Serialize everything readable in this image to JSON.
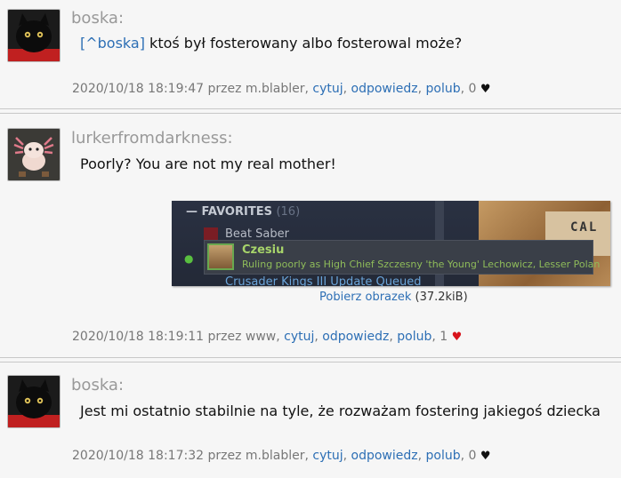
{
  "posts": [
    {
      "author": "boska:",
      "reply_link": "[^boska]",
      "text": " ktoś był fosterowany albo fosterowal może?",
      "meta": {
        "prefix": "2020/10/18 18:19:47 przez m.blabler, ",
        "cytuj": "cytuj",
        "odpowiedz": "odpowiedz",
        "polub": "polub",
        "likes": "0",
        "heart": "♥",
        "heart_color": "#111111"
      }
    },
    {
      "author": "lurkerfromdarkness:",
      "text": "Poorly? You are not my real mother!",
      "image": {
        "favorites": "— FAVORITES",
        "favorites_count": "(16)",
        "game1": "Beat Saber",
        "game2": "Crusader Kings III   Update Queued",
        "popup_name": "Czesiu",
        "popup_status": "Ruling poorly as High Chief Szczesny 'the Young' Lechowicz, Lesser Polan",
        "card_text": "CAL"
      },
      "download": {
        "link": "Pobierz obrazek",
        "size": " (37.2kiB)"
      },
      "meta": {
        "prefix": "2020/10/18 18:19:11 przez www, ",
        "cytuj": "cytuj",
        "odpowiedz": "odpowiedz",
        "polub": "polub",
        "likes": "1",
        "heart": "♥",
        "heart_color": "#d8141c"
      }
    },
    {
      "author": "boska:",
      "text": "Jest mi ostatnio stabilnie na tyle, że rozważam fostering jakiegoś dziecka",
      "meta": {
        "prefix": "2020/10/18 18:17:32 przez m.blabler, ",
        "cytuj": "cytuj",
        "odpowiedz": "odpowiedz",
        "polub": "polub",
        "likes": "0",
        "heart": "♥",
        "heart_color": "#111111"
      }
    }
  ]
}
